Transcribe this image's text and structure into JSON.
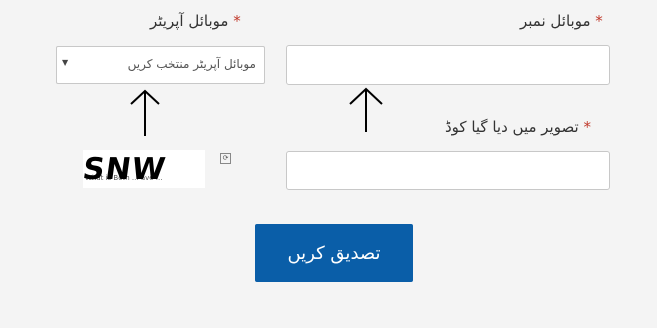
{
  "form": {
    "mobile_number": {
      "label": "موبائل نمبر",
      "required_mark": "*",
      "value": ""
    },
    "mobile_operator": {
      "label": "موبائل آپریٹر",
      "required_mark": "*",
      "selected": "موبائل آپریٹر منتخب کریں"
    },
    "captcha_code": {
      "label": "تصویر میں دیا گیا کوڈ",
      "required_mark": "*",
      "value": ""
    },
    "captcha_image": {
      "text": "SNW",
      "small_text": "What is Both ... ave ..."
    },
    "submit_label": "تصدیق کریں"
  },
  "colors": {
    "accent": "#0a5ea8",
    "required": "#c0392b"
  }
}
